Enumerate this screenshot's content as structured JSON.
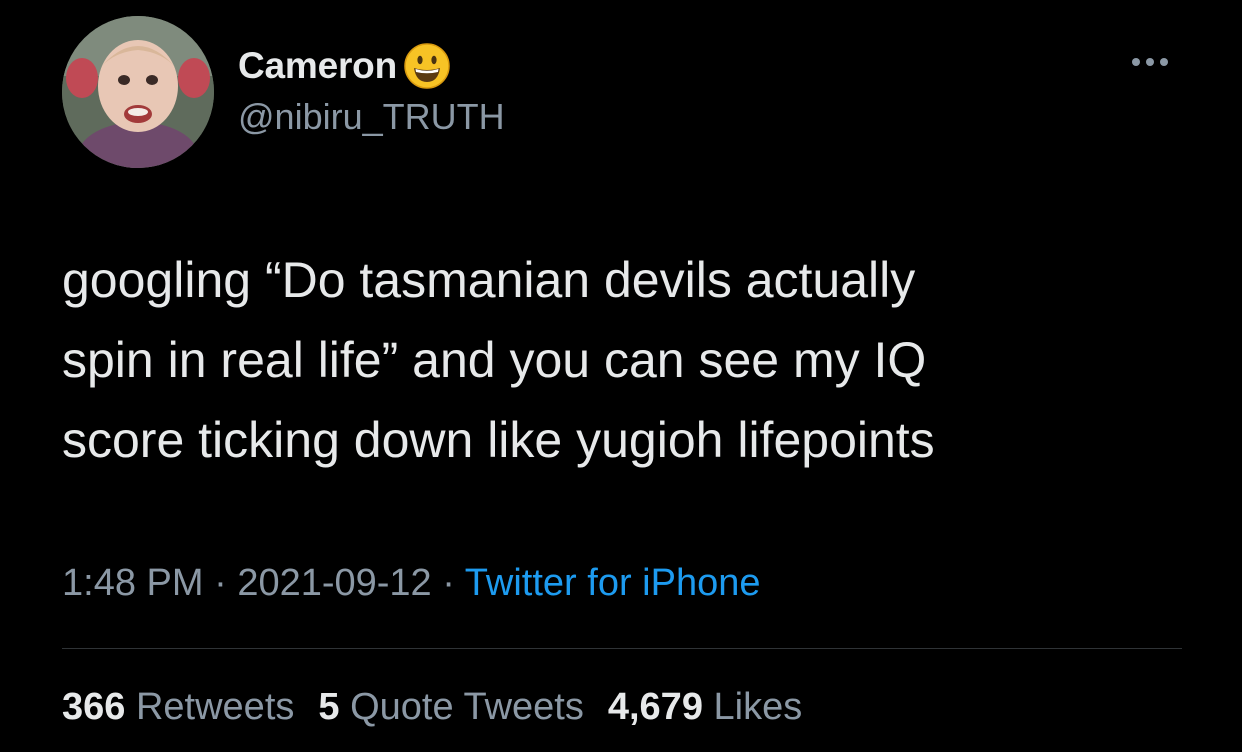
{
  "author": {
    "display_name": "Cameron",
    "handle": "@nibiru_TRUTH",
    "name_emoji": "smiling-face-emoji"
  },
  "tweet": {
    "text": "googling “Do tasmanian devils actually\nspin in real life” and you can see my IQ\nscore ticking down like yugioh lifepoints"
  },
  "meta": {
    "time": "1:48 PM",
    "separator": " · ",
    "date": "2021-09-12",
    "source": "Twitter for iPhone"
  },
  "stats": {
    "retweets_count": "366",
    "retweets_label": "Retweets",
    "quotes_count": "5",
    "quotes_label": "Quote Tweets",
    "likes_count": "4,679",
    "likes_label": "Likes"
  },
  "colors": {
    "background": "#000000",
    "primary_text": "#e7e9ea",
    "secondary_text": "#8b98a5",
    "link": "#1d9bf0",
    "divider": "#2f3336"
  }
}
